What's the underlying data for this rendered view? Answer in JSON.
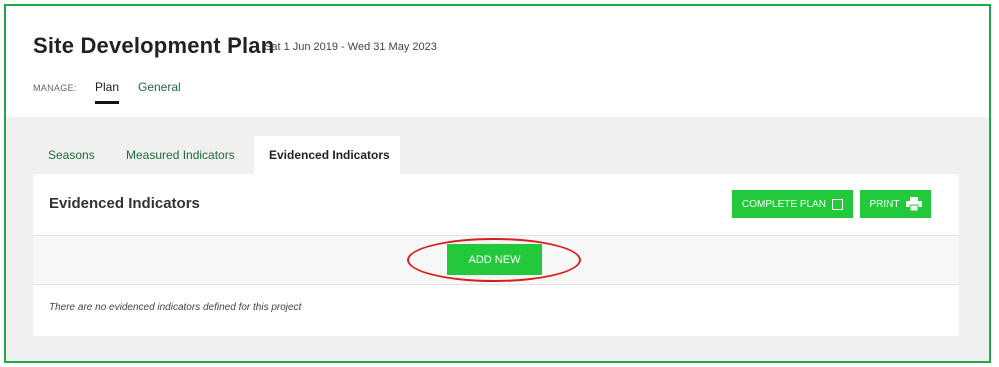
{
  "header": {
    "title": "Site Development Plan",
    "date_range": "Sat 1 Jun 2019 - Wed 31 May 2023",
    "manage_label": "MANAGE:",
    "manage_tabs": [
      {
        "label": "Plan",
        "active": true
      },
      {
        "label": "General",
        "active": false
      }
    ]
  },
  "tabs": [
    {
      "label": "Seasons",
      "active": false
    },
    {
      "label": "Measured Indicators",
      "active": false
    },
    {
      "label": "Evidenced Indicators",
      "active": true
    }
  ],
  "panel": {
    "title": "Evidenced Indicators",
    "complete_plan_label": "COMPLETE PLAN",
    "print_label": "PRINT",
    "add_new_label": "ADD NEW",
    "empty_message": "There are no evidenced indicators defined for this project"
  },
  "colors": {
    "accent_green": "#22c93a",
    "frame_border": "#1fa84a",
    "link_green": "#1e6b3c",
    "highlight_ellipse": "#d62020"
  },
  "icons": {
    "complete_plan": "checkbox-icon",
    "print": "printer-icon"
  }
}
